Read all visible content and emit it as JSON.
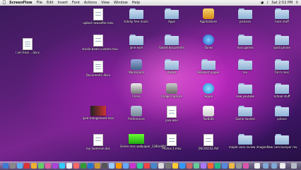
{
  "menubar": {
    "app": "ScreenFlow",
    "menus": [
      "File",
      "Edit",
      "Insert",
      "Font",
      "Actions",
      "View",
      "Window",
      "Help"
    ],
    "clock": "Sat 2:52 PM"
  },
  "icons": [
    {
      "label": "i am from ...docx",
      "type": "doc"
    },
    {
      "label": "upbed newsofter.mov",
      "type": "doc"
    },
    {
      "label": "studio-beats custom.mov",
      "type": "doc"
    },
    {
      "label": "Document1.docx",
      "type": "doc"
    },
    {
      "label": "ipod-mangement-mov",
      "type": "doc"
    },
    {
      "label": "my homerun.doc",
      "type": "doc"
    },
    {
      "label": "totally free music",
      "type": "folder"
    },
    {
      "label": "jane eyre",
      "type": "folder"
    },
    {
      "label": "Workspace",
      "type": "app"
    },
    {
      "label": "Chess",
      "type": "app"
    },
    {
      "label": "Preferences",
      "type": "app"
    },
    {
      "label": "Green mac wallpaper_1280x800",
      "type": "pic"
    },
    {
      "label": "Apps",
      "type": "folder"
    },
    {
      "label": "Saved documents",
      "type": "folder"
    },
    {
      "label": "itunes",
      "type": "folder"
    },
    {
      "label": "Image Capture",
      "type": "app"
    },
    {
      "label": "java.wav",
      "type": "doc"
    },
    {
      "label": "Photos 2.mov",
      "type": "doc"
    },
    {
      "label": "Applications",
      "type": "app"
    },
    {
      "label": "iTunes",
      "type": "app"
    },
    {
      "label": "Research paper",
      "type": "folder"
    },
    {
      "label": "Skype",
      "type": "app"
    },
    {
      "label": "TextEdit",
      "type": "app"
    },
    {
      "label": "DSC00152.AVI",
      "type": "doc"
    },
    {
      "label": "pictures",
      "type": "folder"
    },
    {
      "label": "mac games",
      "type": "folder"
    },
    {
      "label": "rev",
      "type": "folder"
    },
    {
      "label": "new youtube",
      "type": "folder"
    },
    {
      "label": "Game hashes",
      "type": "folder"
    },
    {
      "label": "maple case review images",
      "type": "folder"
    },
    {
      "label": "hack stuff",
      "type": "folder"
    },
    {
      "label": "ipod iphone",
      "type": "folder"
    },
    {
      "label": "Tim's misc",
      "type": "folder"
    },
    {
      "label": "school stuff",
      "type": "folder"
    },
    {
      "label": "iphone",
      "type": "folder"
    },
    {
      "label": "New cam bumper rev",
      "type": "folder"
    }
  ]
}
